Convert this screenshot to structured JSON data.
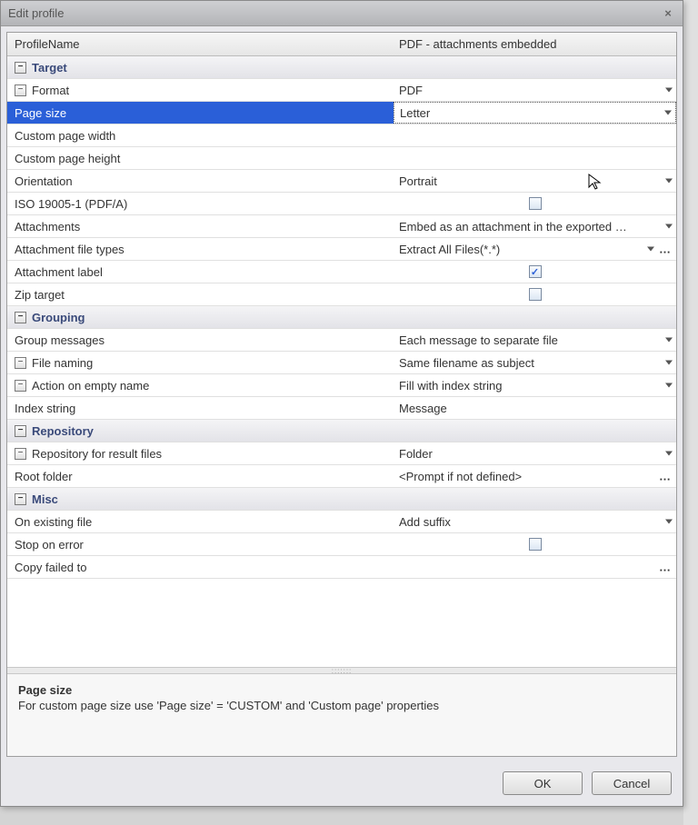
{
  "window": {
    "title": "Edit profile",
    "close": "×"
  },
  "header": {
    "name_col": "ProfileName",
    "value_col": "PDF - attachments embedded"
  },
  "sections": {
    "target": "Target",
    "grouping": "Grouping",
    "repository": "Repository",
    "misc": "Misc"
  },
  "target": {
    "format_label": "Format",
    "format_value": "PDF",
    "page_size_label": "Page size",
    "page_size_value": "Letter",
    "custom_width_label": "Custom page width",
    "custom_width_value": "",
    "custom_height_label": "Custom page height",
    "custom_height_value": "",
    "orientation_label": "Orientation",
    "orientation_value": "Portrait",
    "iso_label": "ISO 19005-1 (PDF/A)",
    "attachments_label": "Attachments",
    "attachments_value": "Embed as an attachment in the exported …",
    "attach_types_label": "Attachment file types",
    "attach_types_value": "Extract All Files(*.*)",
    "attach_label_label": "Attachment label",
    "zip_label": "Zip target"
  },
  "grouping": {
    "group_msgs_label": "Group messages",
    "group_msgs_value": "Each message to separate file",
    "file_naming_label": "File naming",
    "file_naming_value": "Same filename as subject",
    "action_empty_label": "Action on empty name",
    "action_empty_value": "Fill with index string",
    "index_str_label": "Index string",
    "index_str_value": "Message"
  },
  "repository": {
    "repo_for_label": "Repository for result files",
    "repo_for_value": "Folder",
    "root_folder_label": "Root folder",
    "root_folder_value": "<Prompt if not defined>"
  },
  "misc": {
    "existing_label": "On existing file",
    "existing_value": "Add suffix",
    "stop_err_label": "Stop on error",
    "copy_failed_label": "Copy failed to"
  },
  "help": {
    "title": "Page size",
    "text": "For custom page size use 'Page size' = 'CUSTOM' and 'Custom page' properties"
  },
  "buttons": {
    "ok": "OK",
    "cancel": "Cancel"
  },
  "glyphs": {
    "minus": "−"
  }
}
